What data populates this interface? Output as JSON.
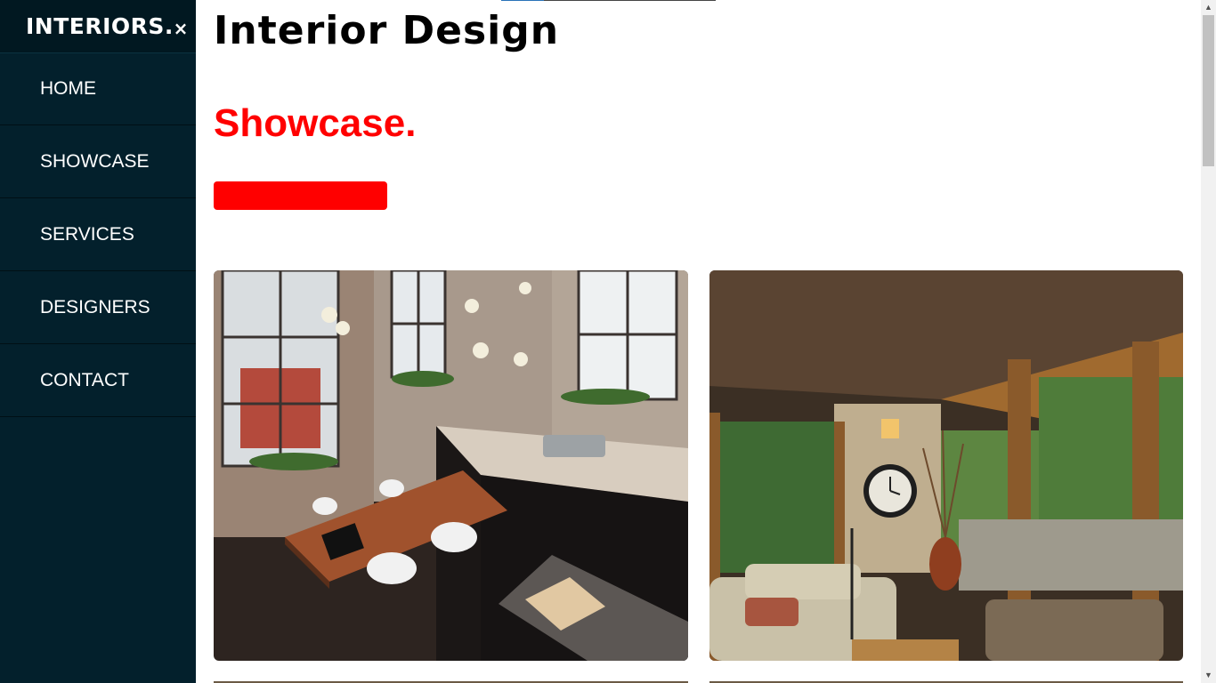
{
  "sidebar": {
    "brand": "INTERIORS.",
    "close_label": "×",
    "items": [
      {
        "label": "HOME"
      },
      {
        "label": "SHOWCASE"
      },
      {
        "label": "SERVICES"
      },
      {
        "label": "DESIGNERS"
      },
      {
        "label": "CONTACT"
      }
    ]
  },
  "header": {
    "title": "Interior Design"
  },
  "showcase": {
    "title": "Showcase.",
    "images": [
      {
        "subject": "industrial loft kitchen with brick walls and wooden table"
      },
      {
        "subject": "covered porch lounge with sofa, wall clock and garden view"
      }
    ]
  },
  "colors": {
    "sidebar_bg": "#03202c",
    "sidebar_header_bg": "#011821",
    "accent": "#ff0000",
    "text_dark": "#000000",
    "text_light": "#ffffff"
  },
  "icons": {
    "close": "close-icon",
    "scroll_up": "chevron-up-icon",
    "scroll_down": "chevron-down-icon"
  }
}
